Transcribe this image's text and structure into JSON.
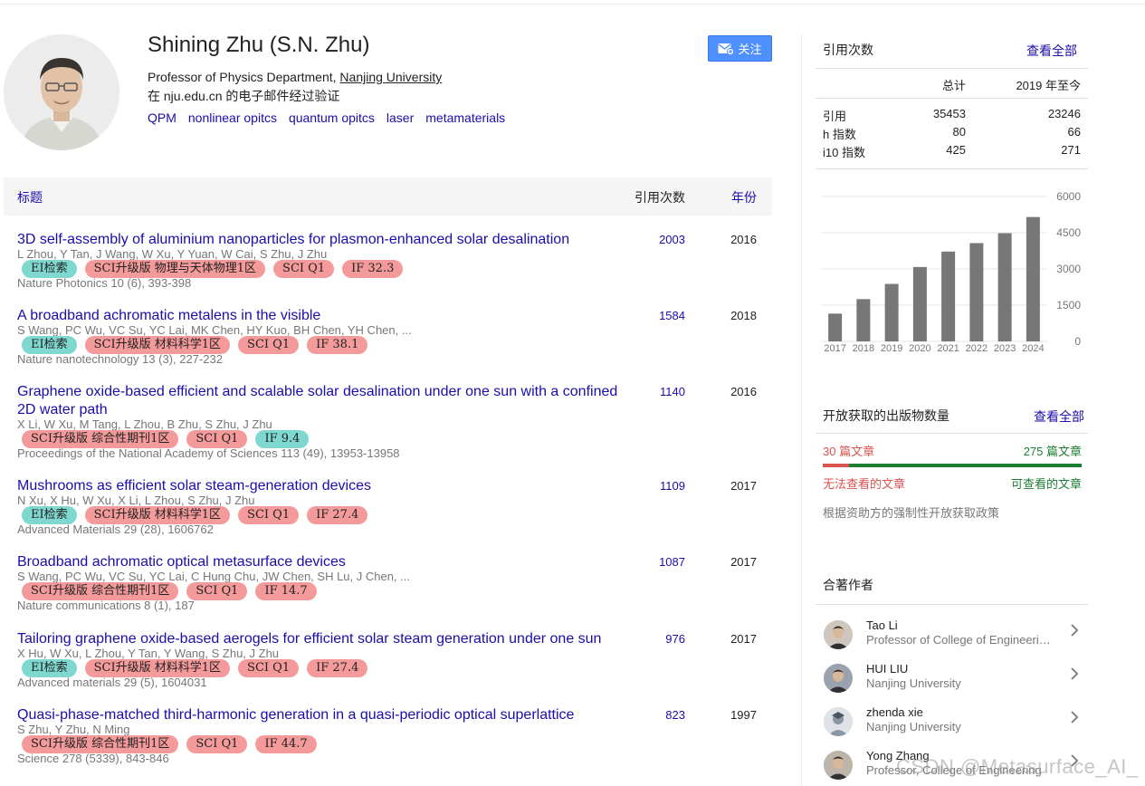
{
  "profile": {
    "name": "Shining Zhu (S.N. Zhu)",
    "affiliation_prefix": "Professor of Physics Department, ",
    "affiliation_org": "Nanjing University",
    "verified": "在 nju.edu.cn 的电子邮件经过验证",
    "interests": [
      "QPM",
      "nonlinear opitcs",
      "quantum opitcs",
      "laser",
      "metamaterials"
    ],
    "follow_label": "关注"
  },
  "table": {
    "col_title": "标题",
    "col_cited": "引用次数",
    "col_year": "年份"
  },
  "publications": [
    {
      "title": "3D self-assembly of aluminium nanoparticles for plasmon-enhanced solar desalination",
      "authors": "L Zhou, Y Tan, J Wang, W Xu, Y Yuan, W Cai, S Zhu, J Zhu",
      "tags": [
        {
          "text": "EI检索",
          "color": "teal"
        },
        {
          "text": "SCI升级版 物理与天体物理1区",
          "color": "pink"
        },
        {
          "text": "SCI Q1",
          "color": "pink"
        },
        {
          "text": "IF 32.3",
          "color": "pink"
        }
      ],
      "venue": "Nature Photonics 10 (6), 393-398",
      "cited": "2003",
      "year": "2016"
    },
    {
      "title": "A broadband achromatic metalens in the visible",
      "authors": "S Wang, PC Wu, VC Su, YC Lai, MK Chen, HY Kuo, BH Chen, YH Chen, ...",
      "tags": [
        {
          "text": "EI检索",
          "color": "teal"
        },
        {
          "text": "SCI升级版 材料科学1区",
          "color": "pink"
        },
        {
          "text": "SCI Q1",
          "color": "pink"
        },
        {
          "text": "IF 38.1",
          "color": "pink"
        }
      ],
      "venue": "Nature nanotechnology 13 (3), 227-232",
      "cited": "1584",
      "year": "2018"
    },
    {
      "title": "Graphene oxide-based efficient and scalable solar desalination under one sun with a confined 2D water path",
      "authors": "X Li, W Xu, M Tang, L Zhou, B Zhu, S Zhu, J Zhu",
      "tags": [
        {
          "text": "SCI升级版 综合性期刊1区",
          "color": "pink"
        },
        {
          "text": "SCI Q1",
          "color": "pink"
        },
        {
          "text": "IF 9.4",
          "color": "teal"
        }
      ],
      "venue": "Proceedings of the National Academy of Sciences 113 (49), 13953-13958",
      "cited": "1140",
      "year": "2016"
    },
    {
      "title": "Mushrooms as efficient solar steam-generation devices",
      "authors": "N Xu, X Hu, W Xu, X Li, L Zhou, S Zhu, J Zhu",
      "tags": [
        {
          "text": "EI检索",
          "color": "teal"
        },
        {
          "text": "SCI升级版 材料科学1区",
          "color": "pink"
        },
        {
          "text": "SCI Q1",
          "color": "pink"
        },
        {
          "text": "IF 27.4",
          "color": "pink"
        }
      ],
      "venue": "Advanced Materials 29 (28), 1606762",
      "cited": "1109",
      "year": "2017"
    },
    {
      "title": "Broadband achromatic optical metasurface devices",
      "authors": "S Wang, PC Wu, VC Su, YC Lai, C Hung Chu, JW Chen, SH Lu, J Chen, ...",
      "tags": [
        {
          "text": "SCI升级版 综合性期刊1区",
          "color": "pink"
        },
        {
          "text": "SCI Q1",
          "color": "pink"
        },
        {
          "text": "IF 14.7",
          "color": "pink"
        }
      ],
      "venue": "Nature communications 8 (1), 187",
      "cited": "1087",
      "year": "2017"
    },
    {
      "title": "Tailoring graphene oxide-based aerogels for efficient solar steam generation under one sun",
      "authors": "X Hu, W Xu, L Zhou, Y Tan, Y Wang, S Zhu, J Zhu",
      "tags": [
        {
          "text": "EI检索",
          "color": "teal"
        },
        {
          "text": "SCI升级版 材料科学1区",
          "color": "pink"
        },
        {
          "text": "SCI Q1",
          "color": "pink"
        },
        {
          "text": "IF 27.4",
          "color": "pink"
        }
      ],
      "venue": "Advanced materials 29 (5), 1604031",
      "cited": "976",
      "year": "2017"
    },
    {
      "title": "Quasi-phase-matched third-harmonic generation in a quasi-periodic optical superlattice",
      "authors": "S Zhu, Y Zhu, N Ming",
      "tags": [
        {
          "text": "SCI升级版 综合性期刊1区",
          "color": "pink"
        },
        {
          "text": "SCI Q1",
          "color": "pink"
        },
        {
          "text": "IF 44.7",
          "color": "pink"
        }
      ],
      "venue": "Science 278 (5339), 843-846",
      "cited": "823",
      "year": "1997"
    }
  ],
  "citations": {
    "title": "引用次数",
    "view_all": "查看全部",
    "header_all": "总计",
    "header_since": "2019 年至今",
    "rows": [
      {
        "label": "引用",
        "all": "35453",
        "since": "23246"
      },
      {
        "label": "h 指数",
        "all": "80",
        "since": "66"
      },
      {
        "label": "i10 指数",
        "all": "425",
        "since": "271"
      }
    ]
  },
  "chart_data": {
    "type": "bar",
    "categories": [
      "2017",
      "2018",
      "2019",
      "2020",
      "2021",
      "2022",
      "2023",
      "2024"
    ],
    "values": [
      1150,
      1750,
      2380,
      3080,
      3720,
      4070,
      4480,
      5150
    ],
    "ylim": [
      0,
      6000
    ],
    "yticks": [
      "6000",
      "4500",
      "3000",
      "1500",
      "0"
    ],
    "bar_color": "#777777",
    "grid": true
  },
  "open_access": {
    "title": "开放获取的出版物数量",
    "view_all": "查看全部",
    "not_available_count": "30 篇文章",
    "available_count": "275 篇文章",
    "not_available_label": "无法查看的文章",
    "available_label": "可查看的文章",
    "mandate_note": "根据资助方的强制性开放获取政策",
    "red": "#d9534f",
    "green": "#1e7e34"
  },
  "coauthors": {
    "title": "合著作者",
    "items": [
      {
        "name": "Tao Li",
        "affiliation": "Professor of College of Engineering and Applied Sciences"
      },
      {
        "name": "HUI LIU",
        "affiliation": "Nanjing University"
      },
      {
        "name": "zhenda xie",
        "affiliation": "Nanjing University"
      },
      {
        "name": "Yong Zhang",
        "affiliation": "Professor, College of Engineering"
      }
    ]
  },
  "watermark": "CSDN @Metasurface_AI_"
}
